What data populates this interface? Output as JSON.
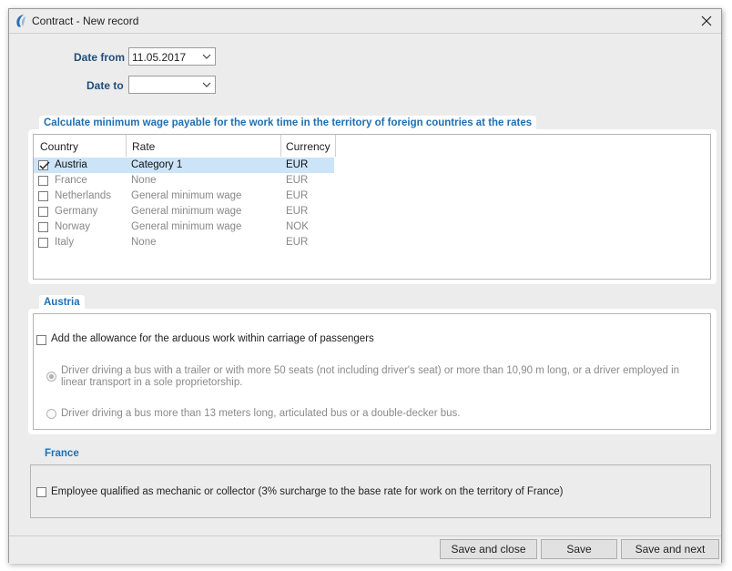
{
  "window": {
    "title": "Contract - New record",
    "logo_icon": "app-logo-icon",
    "close_icon": "close-icon"
  },
  "form": {
    "date_from_label": "Date from",
    "date_from_value": "11.05.2017",
    "date_to_label": "Date to",
    "date_to_value": ""
  },
  "wage_section": {
    "title": "Calculate minimum wage payable for the work time in the territory of foreign countries at the rates",
    "columns": [
      "Country",
      "Rate",
      "Currency"
    ],
    "rows": [
      {
        "country": "Austria",
        "rate": "Category 1",
        "currency": "EUR",
        "checked": true,
        "selected": true
      },
      {
        "country": "France",
        "rate": "None",
        "currency": "EUR",
        "checked": false,
        "selected": false
      },
      {
        "country": "Netherlands",
        "rate": "General minimum wage",
        "currency": "EUR",
        "checked": false,
        "selected": false
      },
      {
        "country": "Germany",
        "rate": "General minimum wage",
        "currency": "EUR",
        "checked": false,
        "selected": false
      },
      {
        "country": "Norway",
        "rate": "General minimum wage",
        "currency": "NOK",
        "checked": false,
        "selected": false
      },
      {
        "country": "Italy",
        "rate": "None",
        "currency": "EUR",
        "checked": false,
        "selected": false
      }
    ]
  },
  "austria_section": {
    "title": "Austria",
    "allowance_label": "Add the allowance for the arduous work within carriage of passengers",
    "option1_line1": "Driver driving a bus with a trailer or with more 50 seats (not including driver's seat) or more than 10,90 m long, or a driver employed in",
    "option1_line2": "linear transport in a sole proprietorship.",
    "option2": "Driver driving a bus more than 13 meters long, articulated bus or a double-decker bus."
  },
  "france_section": {
    "title": "France",
    "mechanic_label": "Employee qualified as mechanic or collector (3% surcharge to the base rate for work on the territory of France)"
  },
  "footer": {
    "save_close": "Save and close",
    "save": "Save",
    "save_next": "Save and next"
  },
  "colors": {
    "accent": "#1f6fb2",
    "label": "#1f4e79",
    "selection": "#cce4f7",
    "window_bg": "#ececec"
  }
}
